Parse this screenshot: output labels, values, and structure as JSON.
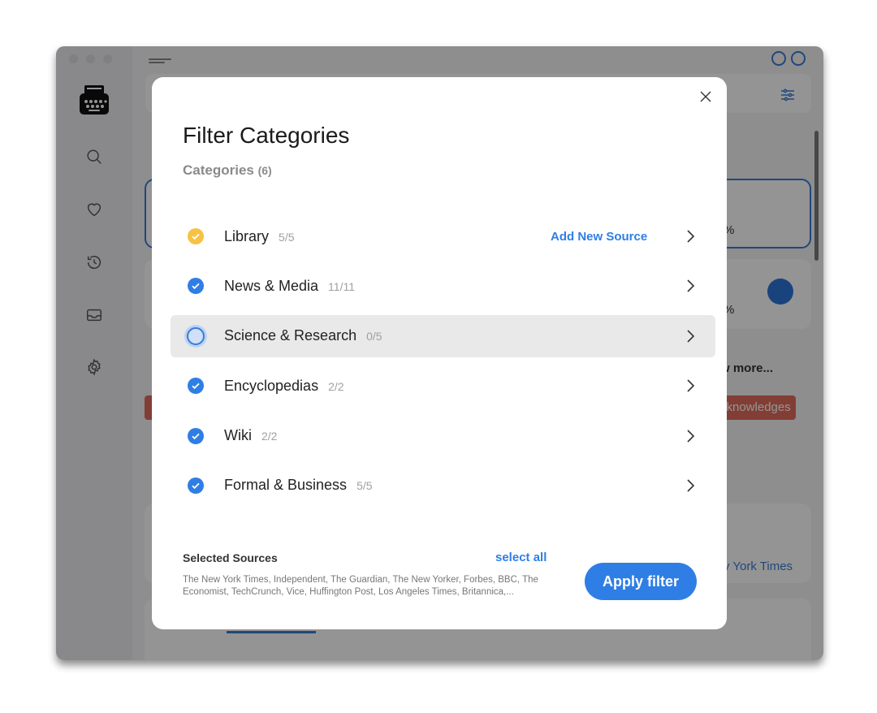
{
  "background": {
    "partial_texts": {
      "percent_1": "%",
      "percent_2": "%",
      "show_more": "w more... ",
      "tag": "cknowledges",
      "source_link": "y York Times"
    }
  },
  "modal": {
    "title": "Filter Categories",
    "subtitle": "Categories",
    "subtitle_count": "(6)",
    "categories": [
      {
        "label": "Library",
        "count": "5/5",
        "state": "partial",
        "action": "Add New Source"
      },
      {
        "label": "News & Media",
        "count": "11/11",
        "state": "checked"
      },
      {
        "label": "Science & Research",
        "count": "0/5",
        "state": "unchecked"
      },
      {
        "label": "Encyclopedias",
        "count": "2/2",
        "state": "checked"
      },
      {
        "label": "Wiki",
        "count": "2/2",
        "state": "checked"
      },
      {
        "label": "Formal & Business",
        "count": "5/5",
        "state": "checked"
      }
    ],
    "selected_sources_title": "Selected Sources",
    "select_all_label": "select all",
    "selected_sources_text": "The New York Times, Independent, The Guardian, The New Yorker, Forbes, BBC, The Economist, TechCrunch, Vice, Huffington Post, Los Angeles Times, Britannica,...",
    "apply_label": "Apply filter"
  },
  "colors": {
    "accent": "#2f7ee5",
    "partial": "#f7c244",
    "hover_row": "#e9e9ea",
    "tag": "#e06c5a"
  }
}
